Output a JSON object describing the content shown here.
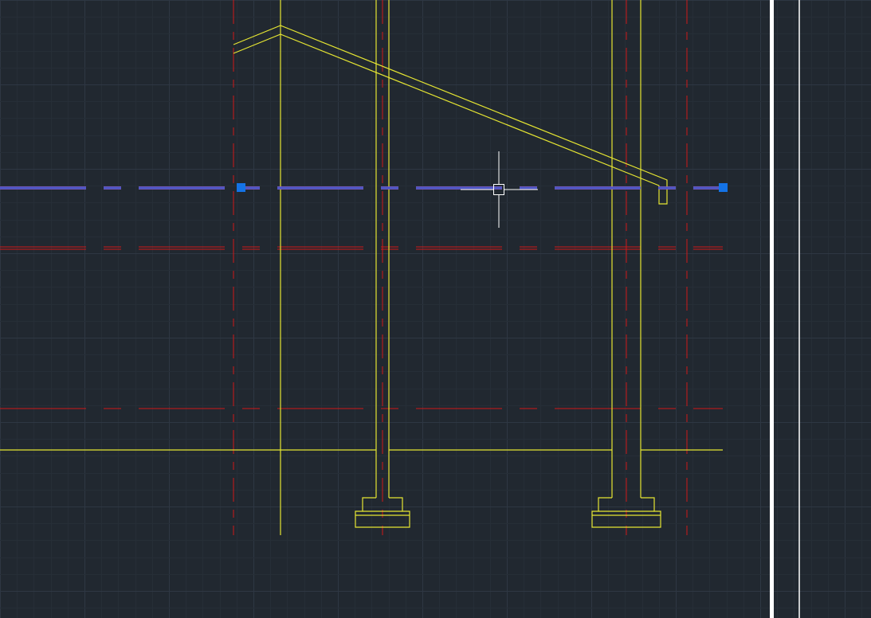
{
  "app": {
    "viewport": "cad-model-space"
  },
  "colors": {
    "background": "#212830",
    "grid_minor": "#262e37",
    "grid_major": "#2e3743",
    "wall": "#e6e632",
    "centerline": "#d01818",
    "selected_line": "#7b5cc8",
    "grip": "#1473e6",
    "cursor": "#ffffff",
    "border": "#ffffff"
  },
  "drawing": {
    "description_icons": [
      "crosshair-cursor-icon",
      "grip-icon"
    ]
  }
}
